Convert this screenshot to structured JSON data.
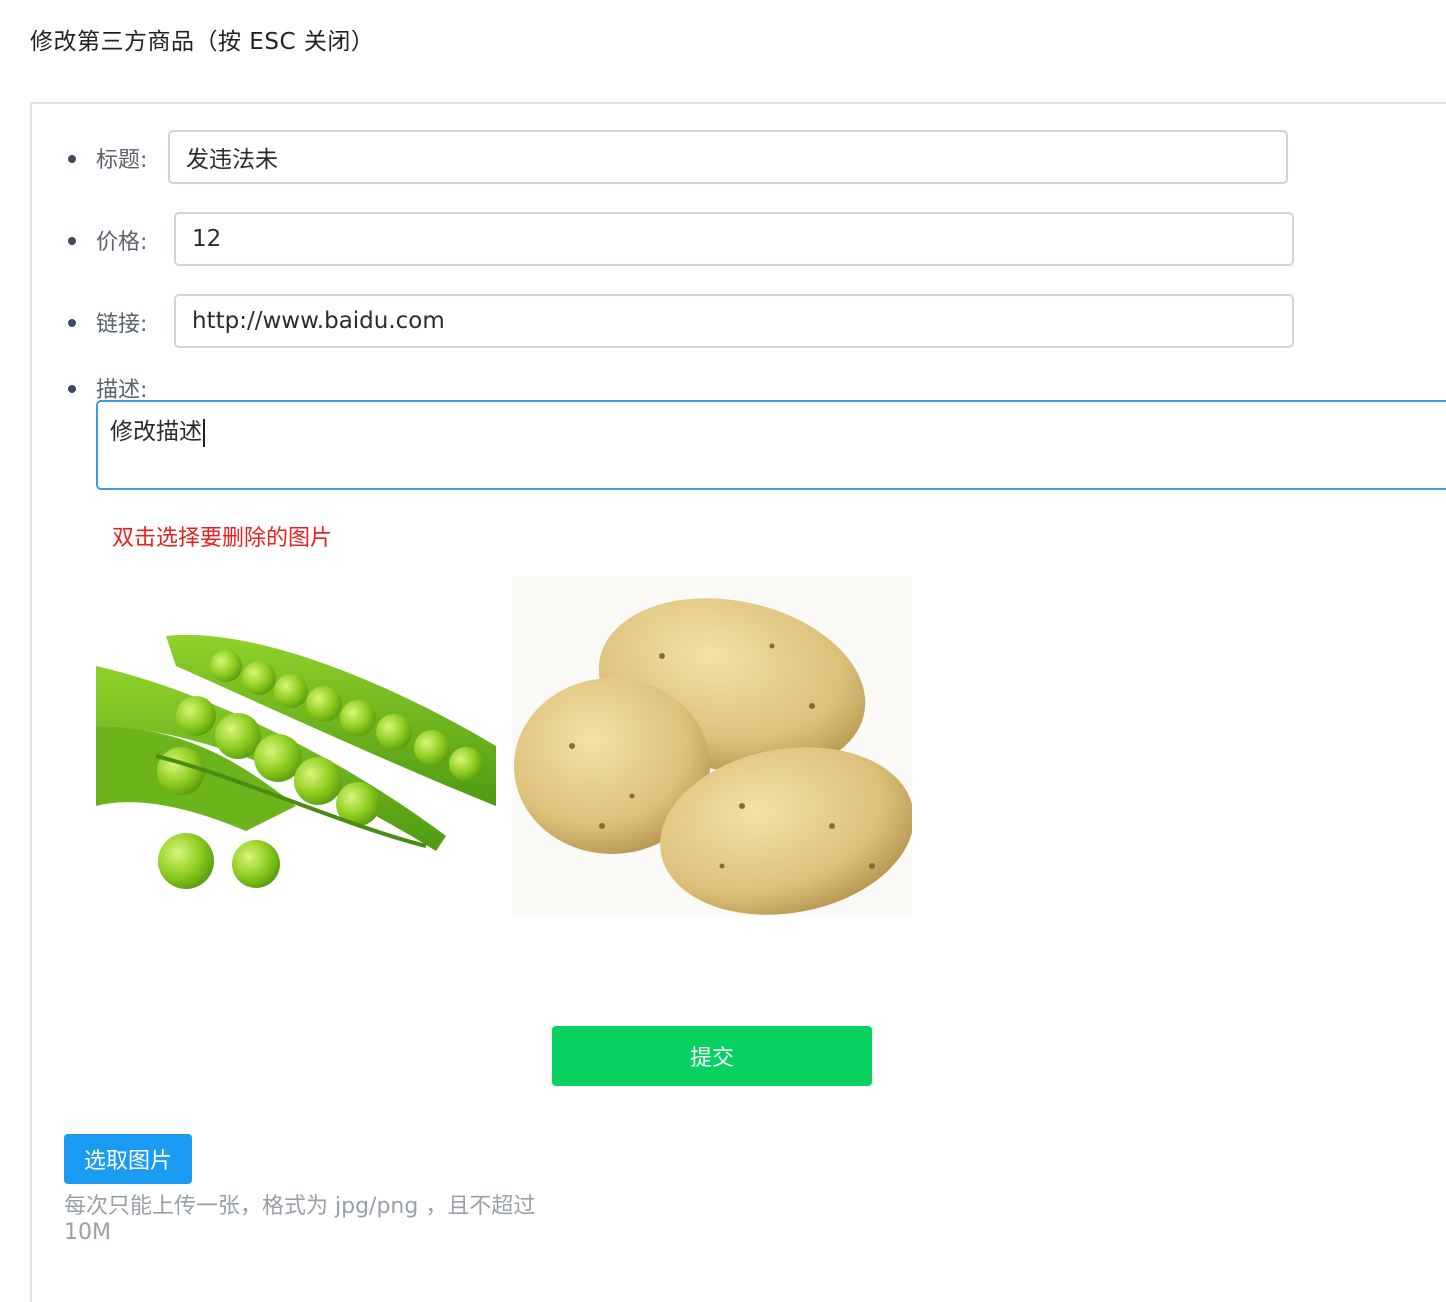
{
  "dialog": {
    "title": "修改第三方商品（按 ESC 关闭）"
  },
  "form": {
    "title_label": "标题:",
    "title_value": "发违法未",
    "price_label": "价格:",
    "price_value": "12",
    "link_label": "链接:",
    "link_value": "http://www.baidu.com",
    "desc_label": "描述:",
    "desc_value": "修改描述"
  },
  "images": {
    "hint": "双击选择要删除的图片",
    "items": [
      {
        "name": "peas-image",
        "subject": "green peas"
      },
      {
        "name": "potatoes-image",
        "subject": "potatoes"
      }
    ]
  },
  "actions": {
    "submit_label": "提交",
    "pick_image_label": "选取图片",
    "upload_note": "每次只能上传一张，格式为 jpg/png ，且不超过 10M"
  },
  "colors": {
    "submit": "#07d160",
    "pick": "#1a9cf2",
    "hint": "#e8211c",
    "focus_border": "#3a9be8"
  }
}
